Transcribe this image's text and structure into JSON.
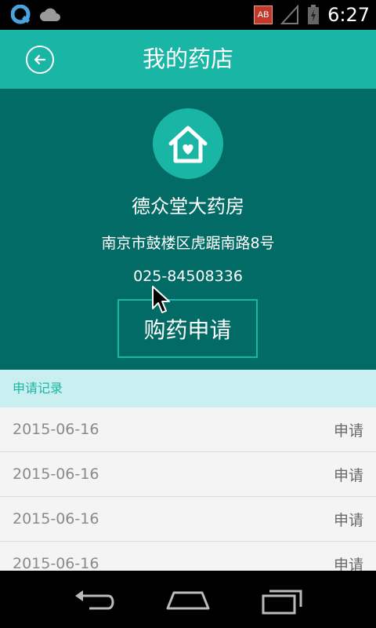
{
  "status_bar": {
    "time": "6:27",
    "badge": "AB",
    "icons": [
      "app-q-icon",
      "cloud-icon",
      "signal-icon",
      "battery-icon"
    ]
  },
  "app_bar": {
    "title": "我的药店",
    "back_icon": "back-arrow-circle-icon"
  },
  "shop": {
    "icon": "house-heart-icon",
    "name": "德众堂大药房",
    "address": "南京市鼓楼区虎踞南路8号",
    "phone": "025-84508336",
    "apply_button": "购药申请"
  },
  "records": {
    "header": "申请记录",
    "items": [
      {
        "date": "2015-06-16",
        "action": "申请"
      },
      {
        "date": "2015-06-16",
        "action": "申请"
      },
      {
        "date": "2015-06-16",
        "action": "申请"
      },
      {
        "date": "2015-06-16",
        "action": "申请"
      }
    ]
  },
  "nav": {
    "icons": [
      "back-icon",
      "home-icon",
      "recents-icon"
    ]
  },
  "colors": {
    "primary": "#19b5a5",
    "panel": "#026b65",
    "section_bg": "#c9eff0"
  }
}
